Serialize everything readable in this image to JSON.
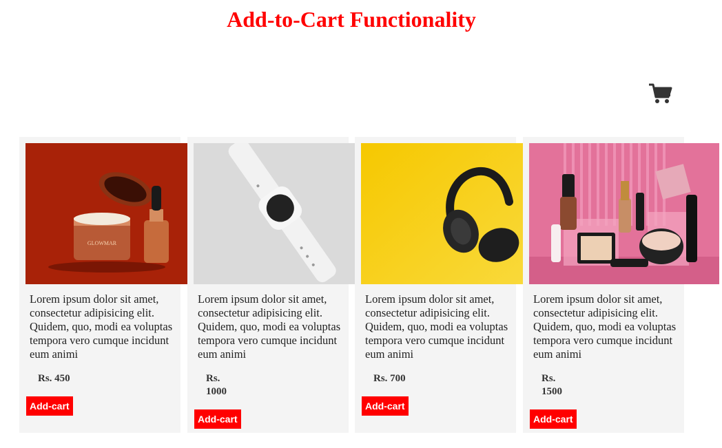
{
  "header": {
    "title": "Add-to-Cart Functionality"
  },
  "cart": {
    "icon": "shopping-cart-icon"
  },
  "products": [
    {
      "image_subject": "skincare-jar-and-serum",
      "description": "Lorem ipsum dolor sit amet, consectetur adipisicing elit. Quidem, quo, modi ea voluptas tempora vero cumque incidunt eum animi",
      "price": "Rs. 450",
      "button_label": "Add-cart"
    },
    {
      "image_subject": "smartwatch",
      "description": "Lorem ipsum dolor sit amet, consectetur adipisicing elit. Quidem, quo, modi ea voluptas tempora vero cumque incidunt eum animi",
      "price": "Rs. 1000",
      "button_label": "Add-cart"
    },
    {
      "image_subject": "headphones",
      "description": "Lorem ipsum dolor sit amet, consectetur adipisicing elit. Quidem, quo, modi ea voluptas tempora vero cumque incidunt eum animi",
      "price": "Rs. 700",
      "button_label": "Add-cart"
    },
    {
      "image_subject": "makeup-products",
      "description": "Lorem ipsum dolor sit amet, consectetur adipisicing elit. Quidem, quo, modi ea voluptas tempora vero cumque incidunt eum animi",
      "price": "Rs. 1500",
      "button_label": "Add-cart"
    }
  ],
  "colors": {
    "accent": "#ff0000",
    "card_background": "#f4f4f4"
  }
}
